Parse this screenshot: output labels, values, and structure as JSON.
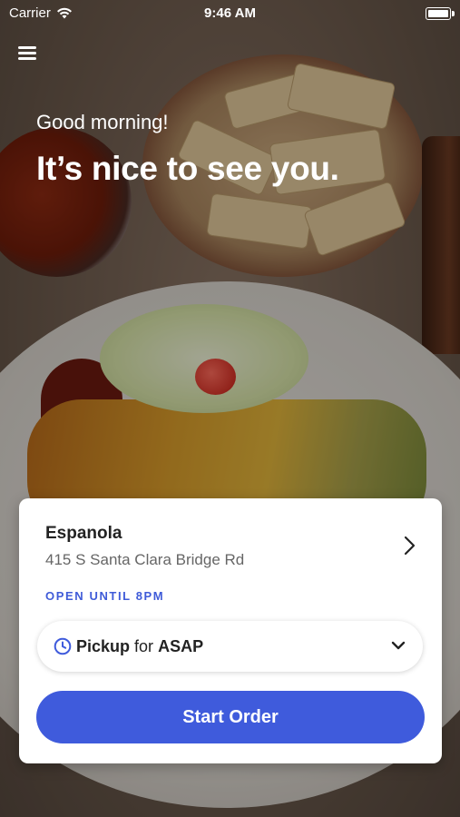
{
  "status_bar": {
    "carrier": "Carrier",
    "time": "9:46 AM"
  },
  "header": {
    "greeting": "Good morning!",
    "headline": "It’s nice to see you."
  },
  "location": {
    "name": "Espanola",
    "address": "415 S Santa Clara Bridge Rd",
    "hours": "OPEN UNTIL 8PM"
  },
  "order_type": {
    "mode": "Pickup",
    "connector": "for",
    "time": "ASAP"
  },
  "actions": {
    "start_order": "Start Order"
  },
  "colors": {
    "accent": "#3f5bdc",
    "hours_text": "#3f5bd8"
  }
}
